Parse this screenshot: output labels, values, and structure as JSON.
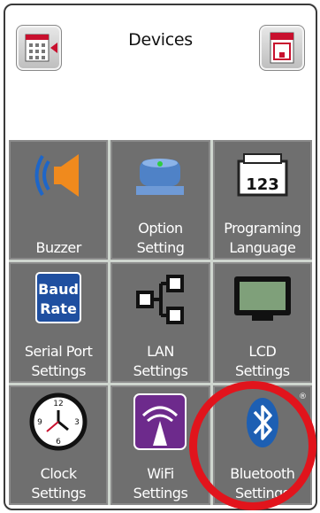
{
  "header": {
    "title": "Devices",
    "left_button_icon": "keypad-back-icon",
    "right_button_icon": "printer-icon"
  },
  "tiles": [
    {
      "label_lines": [
        "Buzzer"
      ],
      "icon": "speaker-icon"
    },
    {
      "label_lines": [
        "Option",
        "Setting"
      ],
      "icon": "option-device-icon"
    },
    {
      "label_lines": [
        "Programing",
        "Language"
      ],
      "icon": "printer-label-icon",
      "icon_text": "123"
    },
    {
      "label_lines": [
        "Serial Port",
        "Settings"
      ],
      "icon": "baud-rate-icon",
      "icon_text": [
        "Baud",
        "Rate"
      ]
    },
    {
      "label_lines": [
        "LAN",
        "Settings"
      ],
      "icon": "network-icon"
    },
    {
      "label_lines": [
        "LCD",
        "Settings"
      ],
      "icon": "monitor-icon"
    },
    {
      "label_lines": [
        "Clock",
        "Settings"
      ],
      "icon": "clock-icon",
      "icon_text": [
        "12",
        "3",
        "6",
        "9"
      ]
    },
    {
      "label_lines": [
        "WiFi",
        "Settings"
      ],
      "icon": "wifi-icon"
    },
    {
      "label_lines": [
        "Bluetooth",
        "Settings"
      ],
      "icon": "bluetooth-icon",
      "icon_text": "®"
    }
  ],
  "colors": {
    "tile_bg": "#6f6f6f",
    "highlight_ring": "#e1141c",
    "speaker": "#f08a1d",
    "wifi_bg": "#6d2a8c",
    "baud_bg": "#1f4fa0",
    "bluetooth": "#1d5fb3"
  }
}
